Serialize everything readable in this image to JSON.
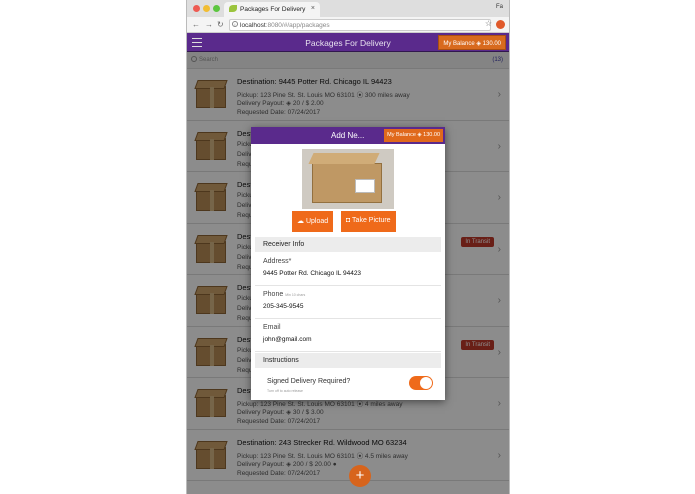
{
  "browser": {
    "tab_title": "Packages For Delivery",
    "tab_close": "×",
    "profile": "Fa",
    "url_host": "localhost",
    "url_path": ":8080/#/app/packages",
    "back": "←",
    "forward": "→",
    "reload": "↻",
    "star": "☆"
  },
  "app": {
    "title": "Packages For Delivery",
    "balance": "My Balance  ◈  130.00",
    "search_placeholder": "Search",
    "count": "(13)",
    "fab": "+"
  },
  "packages": [
    {
      "title": "Destination: 9445 Potter Rd. Chicago IL 94423",
      "pickup": "Pickup: 123 Pine St. St. Louis MO 63101  ⦿ 300 miles away",
      "payout": "Delivery Payout: ◈ 20 / $ 2.00",
      "date": "Requested Date: 07/24/2017",
      "status": ""
    },
    {
      "title": "Destination:",
      "pickup": "Pickup:",
      "payout": "Delivery",
      "date": "Request",
      "status": ""
    },
    {
      "title": "Destination:",
      "pickup": "Pickup:",
      "payout": "Delivery",
      "date": "Request",
      "status": ""
    },
    {
      "title": "Destination:",
      "pickup": "Pickup:",
      "payout": "Delivery",
      "date": "Request",
      "status": "In Transit"
    },
    {
      "title": "Destination:",
      "pickup": "Pickup:",
      "payout": "Delivery",
      "date": "Request",
      "status": ""
    },
    {
      "title": "Destination:",
      "pickup": "Pickup:",
      "payout": "Delivery",
      "date": "Request",
      "status": "In Transit"
    },
    {
      "title": "Destination:",
      "pickup": "Pickup: 123 Pine St. St. Louis MO 63101  ⦿ 4 miles away",
      "payout": "Delivery Payout: ◈ 30 / $ 3.00",
      "date": "Requested Date: 07/24/2017",
      "status": ""
    },
    {
      "title": "Destination: 243 Strecker Rd. Wildwood MO 63234",
      "pickup": "Pickup: 123 Pine St. St. Louis MO 63101  ⦿ 4.5 miles away",
      "payout": "Delivery Payout: ◈ 200 / $ 20.00 ●",
      "date": "Requested Date: 07/24/2017",
      "status": ""
    }
  ],
  "modal": {
    "title": "Add Ne...",
    "balance": "My Balance  ◈  130.00",
    "upload": "☁ Upload",
    "take_picture": "◘ Take Picture",
    "receiver_section": "Receiver Info",
    "address_label": "Address*",
    "address_value": "9445 Potter Rd. Chicago IL 94423",
    "phone_label": "Phone",
    "phone_hint": "Min 10 chars",
    "phone_value": "205-345-9545",
    "email_label": "Email",
    "email_value": "john@gmail.com",
    "instructions_section": "Instructions",
    "signed_label": "Signed Delivery Required?",
    "signed_hint": "Turn off to auto release",
    "signed_on": true
  },
  "colors": {
    "appbar": "#5a2a8c",
    "accent": "#ef6a1a",
    "in_transit": "#c0392b"
  }
}
